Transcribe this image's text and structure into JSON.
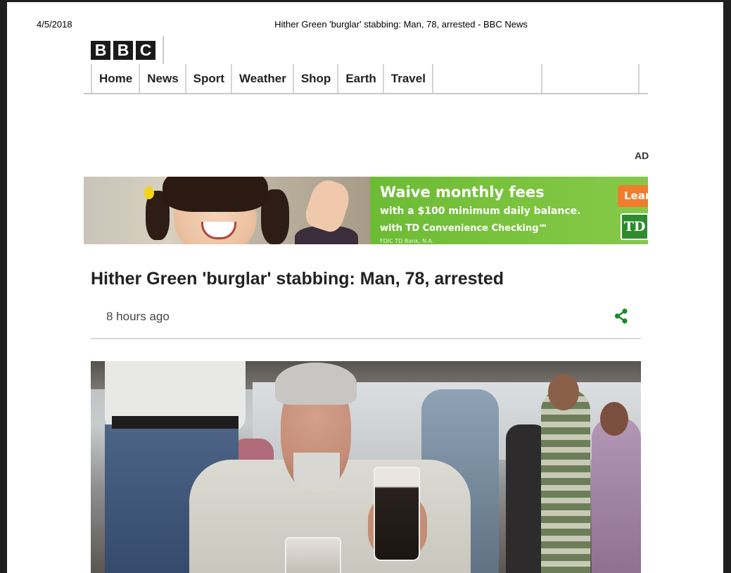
{
  "print_header": {
    "date": "4/5/2018",
    "title": "Hither Green 'burglar' stabbing: Man, 78, arrested - BBC News"
  },
  "logo": {
    "letters": [
      "B",
      "B",
      "C"
    ]
  },
  "nav": {
    "items": [
      {
        "label": "Home"
      },
      {
        "label": "News"
      },
      {
        "label": "Sport"
      },
      {
        "label": "Weather"
      },
      {
        "label": "Shop"
      },
      {
        "label": "Earth"
      },
      {
        "label": "Travel"
      }
    ]
  },
  "ad": {
    "label": "AD",
    "headline": "Waive monthly fees",
    "subline": "with a $100 minimum daily balance.",
    "product": "with TD Convenience Checking℠",
    "legal": "FDIC TD Bank, N.A.",
    "cta": "Lear",
    "brand": "TD",
    "color_green": "#7cc43f",
    "color_cta": "#f07c2c"
  },
  "article": {
    "headline": "Hither Green 'burglar' stabbing: Man, 78, arrested",
    "timestamp": "8 hours ago",
    "share_icon": "share-icon",
    "share_color": "#1a8a2a"
  }
}
